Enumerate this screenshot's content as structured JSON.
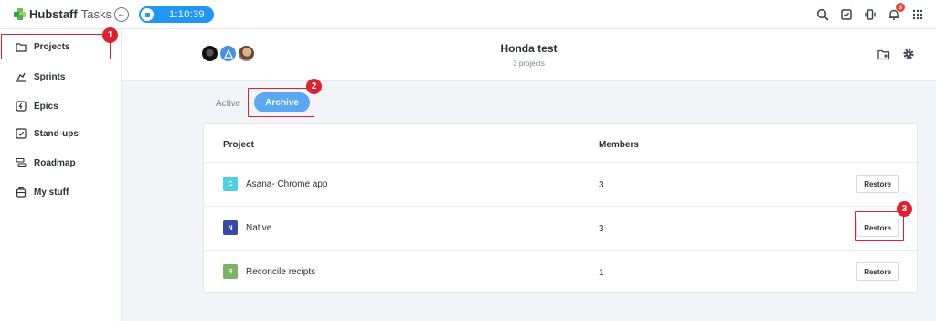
{
  "app": {
    "brand": "Hubstaff",
    "product": "Tasks"
  },
  "timer": {
    "value": "1:10:39",
    "color": "#2196f3"
  },
  "notifications": {
    "count": "3"
  },
  "sidebar": {
    "items": [
      {
        "label": "Projects",
        "icon": "folder-icon"
      },
      {
        "label": "Sprints",
        "icon": "sprint-icon"
      },
      {
        "label": "Epics",
        "icon": "epic-icon"
      },
      {
        "label": "Stand-ups",
        "icon": "checkbox-icon"
      },
      {
        "label": "Roadmap",
        "icon": "roadmap-icon"
      },
      {
        "label": "My stuff",
        "icon": "backpack-icon"
      }
    ]
  },
  "header": {
    "title": "Honda test",
    "subtitle": "3 projects"
  },
  "tabs": {
    "active": "Active",
    "archive": "Archive"
  },
  "table": {
    "columns": {
      "project": "Project",
      "members": "Members"
    },
    "rows": [
      {
        "initial": "C",
        "color": "#4dd0e1",
        "name": "Asana- Chrome app",
        "members": "3",
        "action": "Restore"
      },
      {
        "initial": "N",
        "color": "#3949ab",
        "name": "Native",
        "members": "3",
        "action": "Restore"
      },
      {
        "initial": "R",
        "color": "#7cb36b",
        "name": "Reconcile recipts",
        "members": "1",
        "action": "Restore"
      }
    ]
  },
  "annotations": [
    "1",
    "2",
    "3"
  ],
  "colors": {
    "accent": "#2196f3",
    "archive_tab": "#5aa8f2",
    "highlight": "#e0202e"
  }
}
